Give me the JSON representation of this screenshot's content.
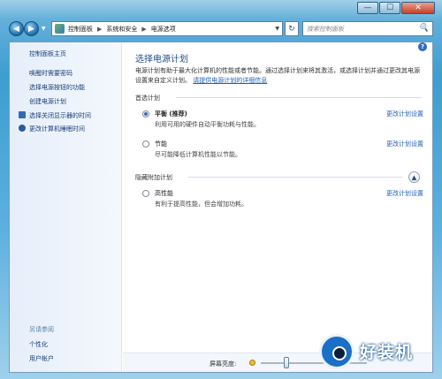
{
  "window": {
    "minimize_glyph": "—",
    "maximize_glyph": "☐",
    "close_glyph": "✕"
  },
  "nav": {
    "back_glyph": "◀",
    "forward_glyph": "▶",
    "recent_glyph": "▼",
    "breadcrumb": [
      "控制面板",
      "系统和安全",
      "电源选项"
    ],
    "breadcrumb_sep": "▶",
    "refresh_glyph": "↻",
    "search_placeholder": "搜索控制面板",
    "search_glyph": "🔍"
  },
  "sidebar": {
    "home": "控制面板主页",
    "links": [
      {
        "label": "唤醒时需要密码",
        "icon": "none"
      },
      {
        "label": "选择电源按钮的功能",
        "icon": "none"
      },
      {
        "label": "创建电源计划",
        "icon": "none"
      },
      {
        "label": "选择关闭显示器的时间",
        "icon": "monitor-icon"
      },
      {
        "label": "更改计算机睡眠时间",
        "icon": "moon-icon"
      }
    ],
    "see_also_title": "另请参阅",
    "see_also": [
      "个性化",
      "用户帐户"
    ]
  },
  "main": {
    "help_glyph": "?",
    "title": "选择电源计划",
    "intro_text": "电源计划有助于最大化计算机的性能或者节能。通过选择计划来将其激活，或选择计划并通过更改其电源设置来自定义计划。",
    "intro_link": "请提供电源计划的详细信息",
    "preferred_title": "首选计划",
    "preferred_plans": [
      {
        "name": "平衡 (推荐)",
        "desc": "利用可用的硬件自动平衡功耗与性能。",
        "checked": true,
        "settings": "更改计划设置"
      },
      {
        "name": "节能",
        "desc": "尽可能降低计算机性能以节能。",
        "checked": false,
        "settings": "更改计划设置"
      }
    ],
    "hidden_title": "隐藏附加计划",
    "collapse_glyph": "▲",
    "hidden_plans": [
      {
        "name": "高性能",
        "desc": "有利于提高性能，但会增加功耗。",
        "checked": false,
        "settings": "更改计划设置"
      }
    ],
    "brightness_label": "屏幕亮度:"
  },
  "watermark": {
    "text": "好装机"
  }
}
